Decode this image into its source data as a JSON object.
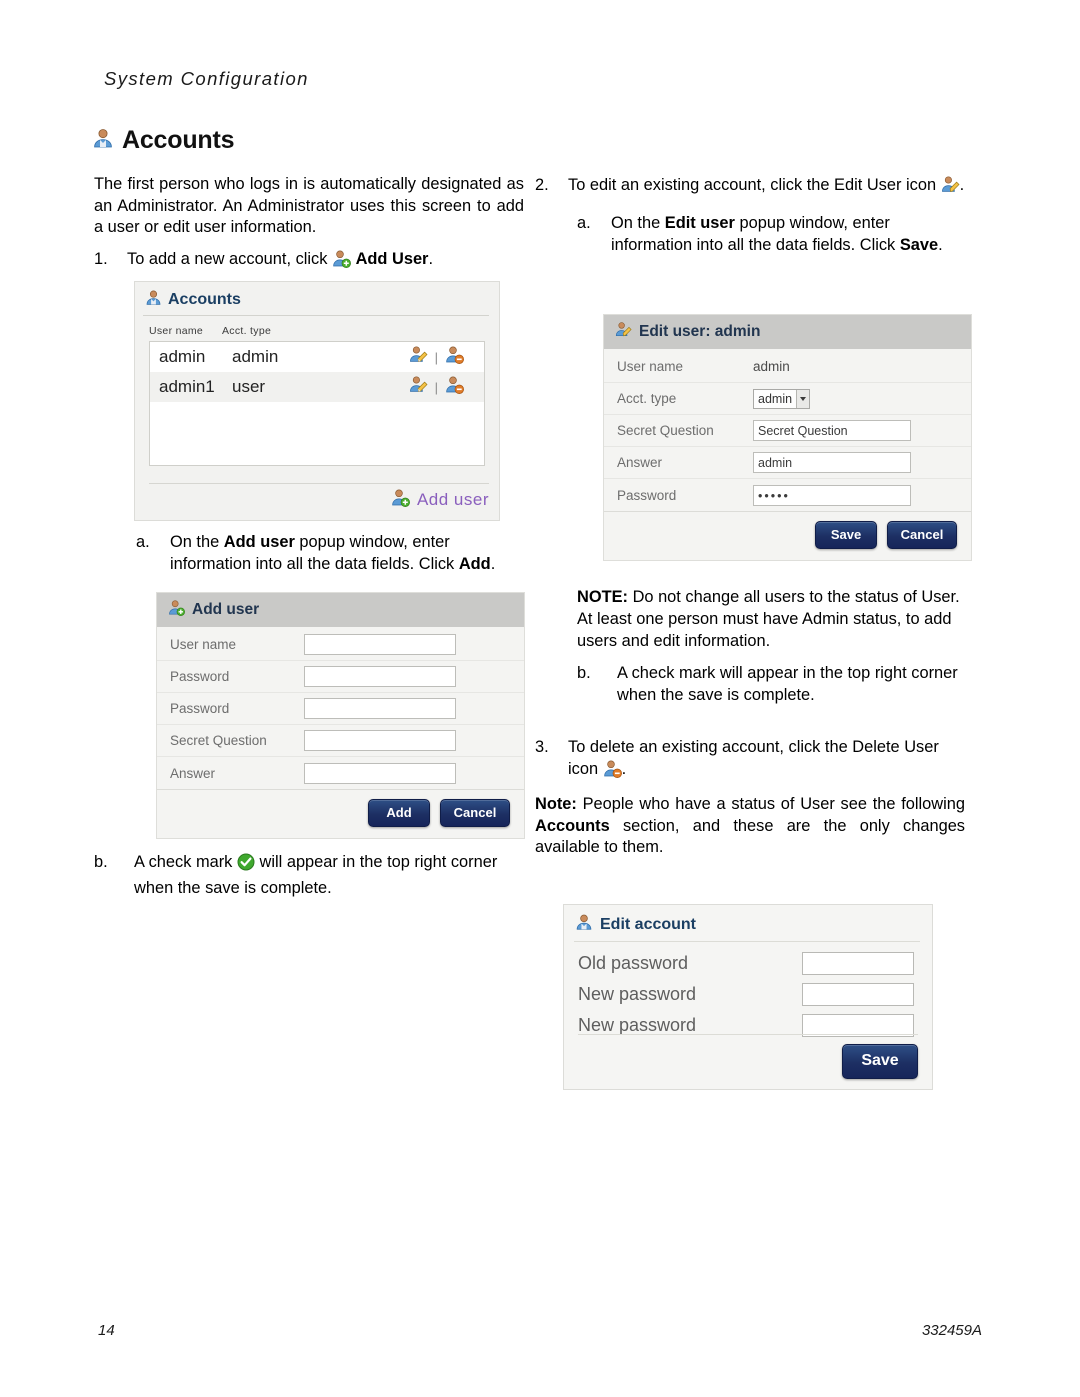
{
  "header": {
    "running_title": "System Configuration"
  },
  "section": {
    "heading": "Accounts",
    "icon": "user-icon"
  },
  "left_column": {
    "intro": "The first person who logs in is automatically designated as an Administrator.  An Administrator uses this screen to add a user or edit user information.",
    "step1": {
      "marker": "1.",
      "text_before": "To add a new account, click",
      "icon": "add-user-icon",
      "bold_text": "Add User",
      "text_after": "."
    },
    "step1a": {
      "marker": "a.",
      "text_before": "On the",
      "bold1": "Add user",
      "text_mid": "popup window, enter information into all the data fields.  Click",
      "bold2": "Add",
      "text_after": "."
    },
    "step1b": {
      "marker": "b.",
      "text_before": "A check mark",
      "icon": "green-check-icon",
      "text_after": "will appear in the top right corner when the save is complete."
    }
  },
  "right_column": {
    "step2": {
      "marker": "2.",
      "text_before": "To edit an existing account, click the Edit User icon",
      "icon": "edit-user-icon",
      "text_after": "."
    },
    "step2a": {
      "marker": "a.",
      "text_before": "On the",
      "bold1": "Edit user",
      "text_mid": "popup window, enter information into all the data fields.  Click",
      "bold2": "Save",
      "text_after": "."
    },
    "note_inline": {
      "bold": "NOTE:",
      "text": "Do not change all users to the status of User.  At least one person must have Admin status, to add users and edit information."
    },
    "step2b": {
      "marker": "b.",
      "text": "A check mark will appear in the top right corner when the save is complete."
    },
    "step3": {
      "marker": "3.",
      "text_before": "To delete an existing account, click the Delete User icon",
      "icon": "delete-user-icon",
      "text_after": "."
    },
    "note_block": {
      "bold1": "Note:",
      "text1": "People who have a status of User see the following",
      "bold2": "Accounts",
      "text2": "section, and these are the only changes available to them."
    }
  },
  "accounts_panel": {
    "title": "Accounts",
    "title_icon": "user-icon",
    "columns": {
      "user_name": "User name",
      "acct_type": "Acct. type"
    },
    "rows": [
      {
        "user_name": "admin",
        "acct_type": "admin",
        "edit_icon": "edit-user-icon",
        "separator": "|",
        "delete_icon": "delete-user-icon"
      },
      {
        "user_name": "admin1",
        "acct_type": "user",
        "edit_icon": "edit-user-icon",
        "separator": "|",
        "delete_icon": "delete-user-icon"
      }
    ],
    "add_link": {
      "icon": "add-user-icon",
      "label": "Add user"
    }
  },
  "add_user_dialog": {
    "title": "Add user",
    "title_icon": "add-user-icon",
    "fields": [
      {
        "label": "User name",
        "value": "",
        "type": "text"
      },
      {
        "label": "Password",
        "value": "",
        "type": "text"
      },
      {
        "label": "Password",
        "value": "",
        "type": "text"
      },
      {
        "label": "Secret Question",
        "value": "",
        "type": "text"
      },
      {
        "label": "Answer",
        "value": "",
        "type": "text"
      }
    ],
    "buttons": {
      "primary": "Add",
      "secondary": "Cancel"
    }
  },
  "edit_user_dialog": {
    "title": "Edit user: admin",
    "title_icon": "edit-user-icon",
    "fields": {
      "user_name_label": "User name",
      "user_name_value": "admin",
      "acct_type_label": "Acct. type",
      "acct_type_value": "admin",
      "secret_question_label": "Secret Question",
      "secret_question_value": "Secret Question",
      "answer_label": "Answer",
      "answer_value": "admin",
      "password_label": "Password",
      "password_value": "•••••"
    },
    "buttons": {
      "primary": "Save",
      "secondary": "Cancel"
    }
  },
  "edit_account_panel": {
    "title": "Edit account",
    "title_icon": "user-icon",
    "fields": [
      {
        "label": "Old password",
        "value": ""
      },
      {
        "label": "New password",
        "value": ""
      },
      {
        "label": "New password",
        "value": ""
      }
    ],
    "button": "Save"
  },
  "footer": {
    "page_number": "14",
    "doc_number": "332459A"
  },
  "colors": {
    "heading": "#111111",
    "panel_title": "#1b3f63",
    "dialog_header_bg": "#c9c9c7",
    "add_link": "#8a5fbd",
    "button_blue": "#1d2f63",
    "field_label": "#6d6d6d"
  }
}
